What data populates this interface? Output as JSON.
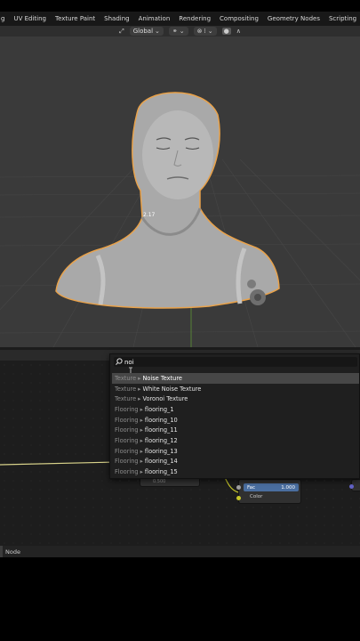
{
  "workspace_tabs": [
    "g",
    "UV Editing",
    "Texture Paint",
    "Shading",
    "Animation",
    "Rendering",
    "Compositing",
    "Geometry Nodes",
    "Scripting"
  ],
  "add_tab_symbol": "+",
  "viewport_header": {
    "transform_orientation": "Global",
    "snap_icon": "magnet-icon",
    "proportional_icon": "proportional-edit-icon"
  },
  "viewport": {
    "vertex_readout": "2.17",
    "object": "head-and-shoulders-scan-mesh"
  },
  "search": {
    "query": "noi",
    "placeholder": "Search..."
  },
  "results": [
    {
      "category": "Texture",
      "item": "Noise Texture",
      "selected": true
    },
    {
      "category": "Texture",
      "item": "White Noise Texture",
      "selected": false
    },
    {
      "category": "Texture",
      "item": "Voronoi Texture",
      "selected": false
    },
    {
      "category": "Flooring",
      "item": "flooring_1",
      "selected": false
    },
    {
      "category": "Flooring",
      "item": "flooring_10",
      "selected": false
    },
    {
      "category": "Flooring",
      "item": "flooring_11",
      "selected": false
    },
    {
      "category": "Flooring",
      "item": "flooring_12",
      "selected": false
    },
    {
      "category": "Flooring",
      "item": "flooring_13",
      "selected": false
    },
    {
      "category": "Flooring",
      "item": "flooring_14",
      "selected": false
    },
    {
      "category": "Flooring",
      "item": "flooring_15",
      "selected": false
    }
  ],
  "result_separator": "▸",
  "nodes": {
    "mix": {
      "fac_label": "Fac",
      "fac_value": "1.000",
      "color_label": "Color"
    },
    "left_value": "0.500"
  },
  "status_bar": {
    "label": "Node"
  },
  "colors": {
    "selection_outline": "#e9a24a",
    "fac_field": "#4a6e9f",
    "socket_gray": "#a1a1a1",
    "socket_yellow": "#c7c729",
    "socket_blue": "#6363c7"
  }
}
